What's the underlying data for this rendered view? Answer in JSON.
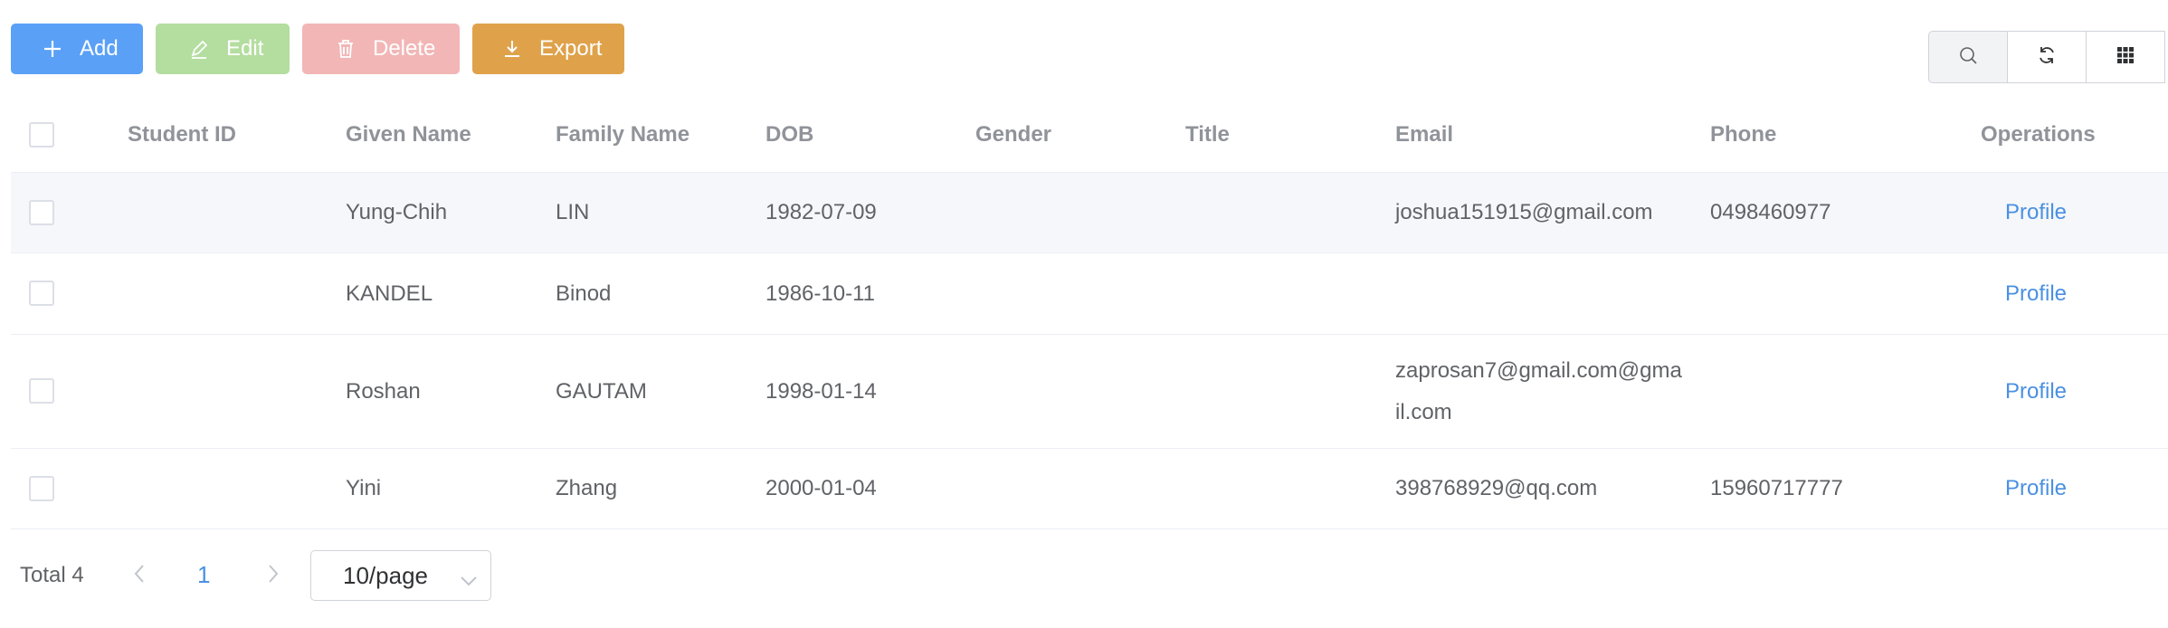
{
  "toolbar": {
    "add_label": "Add",
    "edit_label": "Edit",
    "delete_label": "Delete",
    "export_label": "Export"
  },
  "tools": [
    "search-icon",
    "refresh-icon",
    "grid-icon"
  ],
  "table": {
    "columns": [
      "Student ID",
      "Given Name",
      "Family Name",
      "DOB",
      "Gender",
      "Title",
      "Email",
      "Phone",
      "Operations"
    ],
    "rows": [
      {
        "student_id": "",
        "given_name": "Yung-Chih",
        "family_name": "LIN",
        "dob": "1982-07-09",
        "gender": "",
        "title": "",
        "email": "joshua151915@gmail.com",
        "phone": "0498460977",
        "operation": "Profile"
      },
      {
        "student_id": "",
        "given_name": "KANDEL",
        "family_name": "Binod",
        "dob": "1986-10-11",
        "gender": "",
        "title": "",
        "email": "",
        "phone": "",
        "operation": "Profile"
      },
      {
        "student_id": "",
        "given_name": "Roshan",
        "family_name": "GAUTAM",
        "dob": "1998-01-14",
        "gender": "",
        "title": "",
        "email": "zaprosan7@gmail.com@gmail.com",
        "phone": "",
        "operation": "Profile"
      },
      {
        "student_id": "",
        "given_name": "Yini",
        "family_name": "Zhang",
        "dob": "2000-01-04",
        "gender": "",
        "title": "",
        "email": "398768929@qq.com",
        "phone": "15960717777",
        "operation": "Profile"
      }
    ]
  },
  "pagination": {
    "total_label": "Total 4",
    "current_page": "1",
    "page_size": "10/page"
  },
  "colors": {
    "primary": "#5aa0f7",
    "success_disabled": "#b4dda0",
    "danger_disabled": "#f2b6b6",
    "warning": "#dfa24a",
    "link": "#4a90e2"
  }
}
